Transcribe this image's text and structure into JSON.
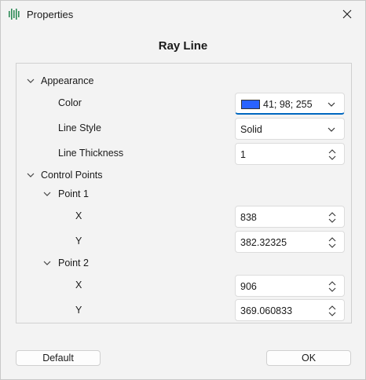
{
  "window": {
    "title": "Properties"
  },
  "dialog": {
    "heading": "Ray Line"
  },
  "appearance": {
    "label": "Appearance",
    "color": {
      "label": "Color",
      "value": "41; 98; 255",
      "swatch": "#2962ff"
    },
    "line_style": {
      "label": "Line Style",
      "value": "Solid"
    },
    "line_thickness": {
      "label": "Line Thickness",
      "value": "1"
    }
  },
  "control_points": {
    "label": "Control Points",
    "point1": {
      "label": "Point 1",
      "x": {
        "label": "X",
        "value": "838"
      },
      "y": {
        "label": "Y",
        "value": "382.32325"
      }
    },
    "point2": {
      "label": "Point 2",
      "x": {
        "label": "X",
        "value": "906"
      },
      "y": {
        "label": "Y",
        "value": "369.060833"
      }
    }
  },
  "buttons": {
    "default": "Default",
    "ok": "OK"
  },
  "colors": {
    "accent": "#0067c0",
    "app_icon": "#2e8b57"
  }
}
